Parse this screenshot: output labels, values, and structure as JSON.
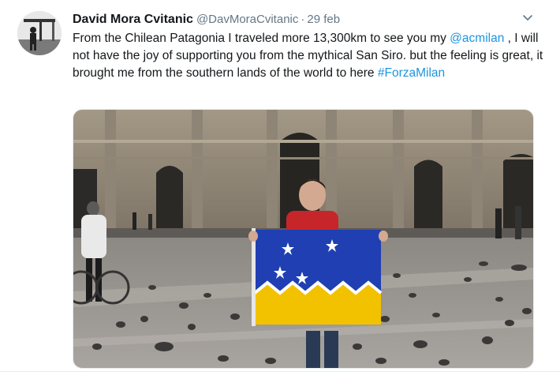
{
  "tweet": {
    "display_name": "David Mora Cvitanic",
    "handle": "@DavMoraCvitanic",
    "separator": "·",
    "date": "29 feb",
    "text_part1": "From the Chilean Patagonia I traveled more 13,300km to see you my ",
    "mention": "@acmilan",
    "text_part2": " , I will not have the joy of supporting you from the mythical San Siro. but the feeling is great, it brought me from the southern lands of the world to here ",
    "hashtag": "#ForzaMilan"
  },
  "icons": {
    "caret": "chevron-down-icon"
  },
  "colors": {
    "link": "#1b95e0",
    "secondary_text": "#657786",
    "flag_blue": "#1f3fb3",
    "flag_yellow": "#f2c200"
  }
}
